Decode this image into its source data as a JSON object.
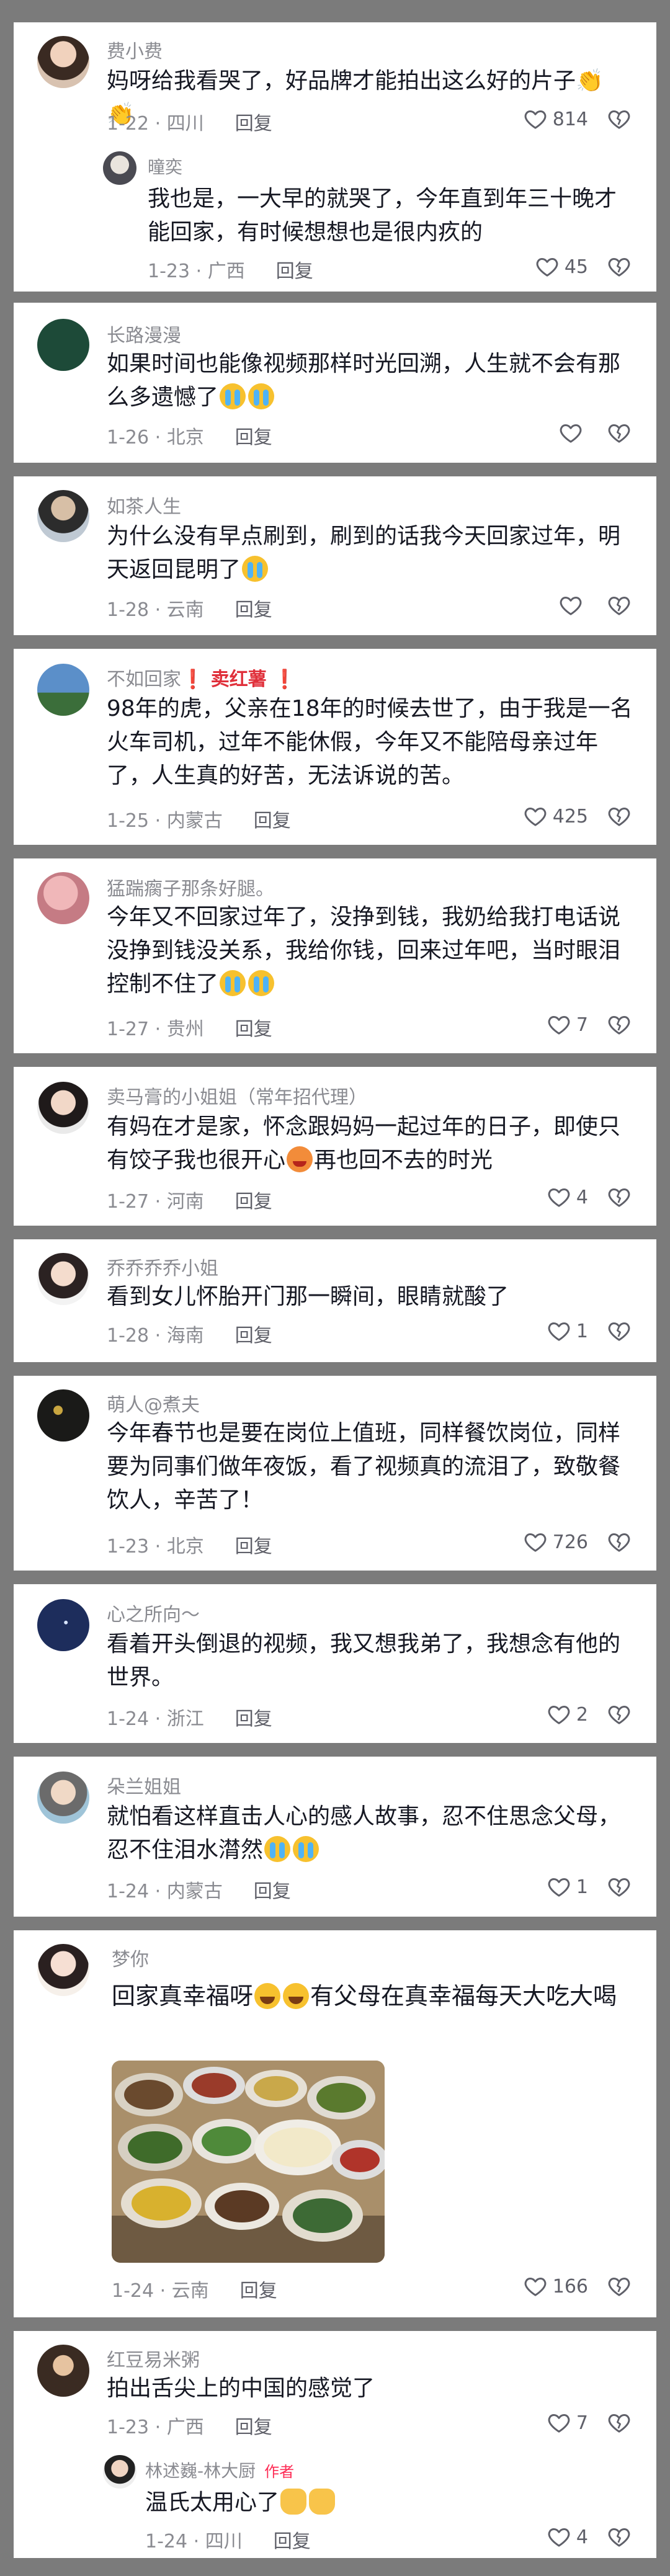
{
  "comments": [
    {
      "name": "费小费",
      "name_extra": "",
      "text": "妈呀给我看哭了，好品牌才能拍出这么好的片子",
      "text_tail": "👏👏",
      "date_loc": "1-22 · 四川",
      "reply": "回复",
      "likes": "814"
    },
    {
      "name": "曈奕",
      "text": "我也是，一大早的就哭了，今年直到年三十晚才能回家，有时候想想也是很内疚的",
      "date_loc": "1-23 · 广西",
      "reply": "回复",
      "likes": "45"
    },
    {
      "name": "长路漫漫",
      "text": "如果时间也能像视频那样时光回溯，人生就不会有那么多遗憾了",
      "date_loc": "1-26 · 北京",
      "reply": "回复",
      "likes": ""
    },
    {
      "name": "如茶人生",
      "text": "为什么没有早点刷到，刷到的话我今天回家过年，明天返回昆明了",
      "date_loc": "1-28 · 云南",
      "reply": "回复",
      "likes": ""
    },
    {
      "name": "不如回家",
      "name_mid": "❗ 卖红薯 ",
      "name_end": "❗",
      "text": "98年的虎，父亲在18年的时候去世了，由于我是一名火车司机，过年不能休假，今年又不能陪母亲过年了，人生真的好苦，无法诉说的苦。",
      "date_loc": "1-25 · 内蒙古",
      "reply": "回复",
      "likes": "425"
    },
    {
      "name": "猛踹瘸子那条好腿。",
      "text": "今年又不回家过年了，没挣到钱，我奶给我打电话说没挣到钱没关系，我给你钱，回来过年吧，当时眼泪控制不住了",
      "date_loc": "1-27 · 贵州",
      "reply": "回复",
      "likes": "7"
    },
    {
      "name": "卖马膏的小姐姐（常年招代理）",
      "text": "有妈在才是家，怀念跟妈妈一起过年的日子，即使只有饺子我也很开心",
      "text_tail": "再也回不去的时光",
      "date_loc": "1-27 · 河南",
      "reply": "回复",
      "likes": "4"
    },
    {
      "name": "乔乔乔乔小姐",
      "text": "看到女儿怀胎开门那一瞬间，眼睛就酸了",
      "date_loc": "1-28 · 海南",
      "reply": "回复",
      "likes": "1"
    },
    {
      "name": "萌人@煮夫",
      "text": "今年春节也是要在岗位上值班，同样餐饮岗位，同样要为同事们做年夜饭，看了视频真的流泪了，致敬餐饮人，辛苦了！",
      "date_loc": "1-23 · 北京",
      "reply": "回复",
      "likes": "726"
    },
    {
      "name": "心之所向～",
      "text": "看着开头倒退的视频，我又想我弟了，我想念有他的世界。",
      "date_loc": "1-24 · 浙江",
      "reply": "回复",
      "likes": "2"
    },
    {
      "name": "朵兰姐姐",
      "text": "就怕看这样直击人心的感人故事，忍不住思念父母，忍不住泪水潸然",
      "date_loc": "1-24 · 内蒙古",
      "reply": "回复",
      "likes": "1"
    },
    {
      "name": "梦你",
      "text": "回家真幸福呀",
      "text_mid": "有父母在真幸福每天大吃大喝",
      "date_loc": "1-24 · 云南",
      "reply": "回复",
      "likes": "166"
    },
    {
      "name": "红豆易米粥",
      "text": "拍出舌尖上的中国的感觉了",
      "date_loc": "1-23 · 广西",
      "reply": "回复",
      "likes": "7"
    },
    {
      "name": "林述巍-林大厨",
      "author_tag": "作者",
      "text": "温氏太用心了",
      "date_loc": "1-24 · 四川",
      "reply": "回复",
      "likes": "4"
    }
  ],
  "icons": {
    "like": "heart-outline-icon",
    "dislike": "broken-heart-icon"
  },
  "colors": {
    "background": "#7b7b7b",
    "card": "#ffffff",
    "muted": "#8a8b91",
    "text": "#161823",
    "accent": "#fe2c55"
  }
}
